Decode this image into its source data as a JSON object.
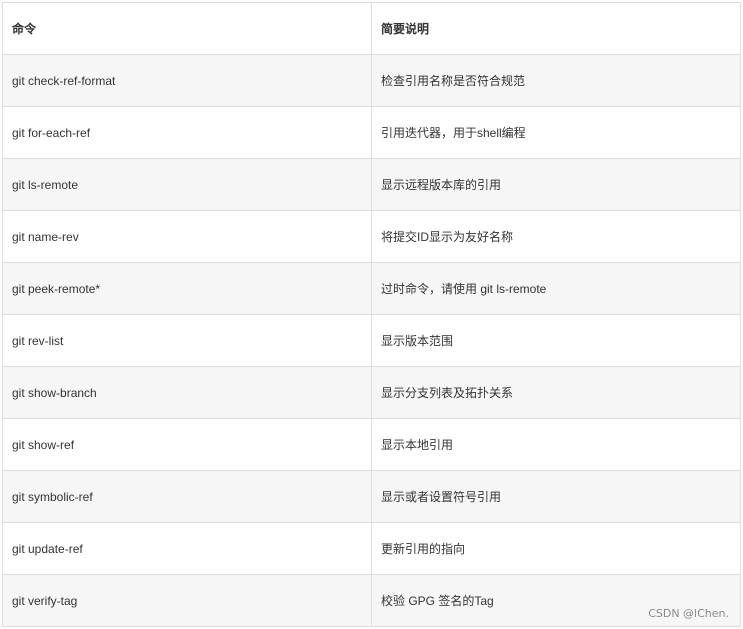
{
  "table": {
    "headers": [
      "命令",
      "简要说明"
    ],
    "rows": [
      [
        "git check-ref-format",
        "检查引用名称是否符合规范"
      ],
      [
        "git for-each-ref",
        "引用迭代器，用于shell编程"
      ],
      [
        "git ls-remote",
        "显示远程版本库的引用"
      ],
      [
        "git name-rev",
        "将提交ID显示为友好名称"
      ],
      [
        "git peek-remote*",
        "过时命令，请使用 git ls-remote"
      ],
      [
        "git rev-list",
        "显示版本范围"
      ],
      [
        "git show-branch",
        "显示分支列表及拓扑关系"
      ],
      [
        "git show-ref",
        "显示本地引用"
      ],
      [
        "git symbolic-ref",
        "显示或者设置符号引用"
      ],
      [
        "git update-ref",
        "更新引用的指向"
      ],
      [
        "git verify-tag",
        "校验 GPG 签名的Tag"
      ]
    ]
  },
  "watermark": "CSDN @lChen."
}
